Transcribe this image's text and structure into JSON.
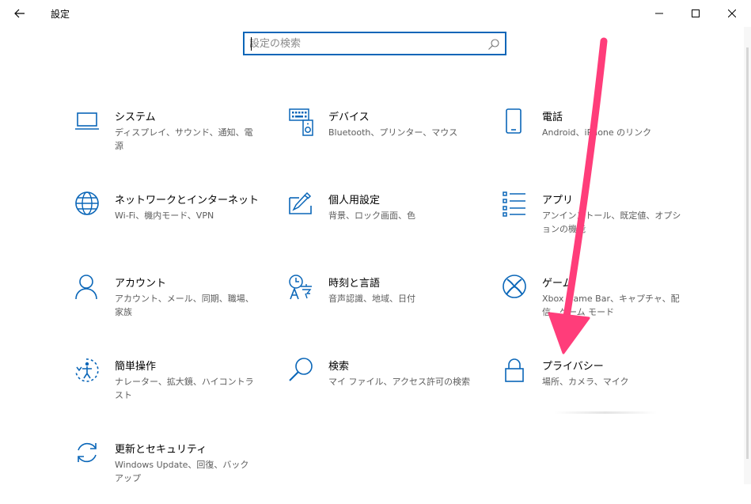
{
  "window": {
    "title": "設定"
  },
  "search": {
    "placeholder": "設定の検索",
    "value": ""
  },
  "tiles": [
    {
      "name": "システム",
      "desc": "ディスプレイ、サウンド、通知、電源",
      "icon": "laptop-icon"
    },
    {
      "name": "デバイス",
      "desc": "Bluetooth、プリンター、マウス",
      "icon": "devices-icon"
    },
    {
      "name": "電話",
      "desc": "Android、iPhone のリンク",
      "icon": "phone-icon"
    },
    {
      "name": "ネットワークとインターネット",
      "desc": "Wi-Fi、機内モード、VPN",
      "icon": "globe-icon"
    },
    {
      "name": "個人用設定",
      "desc": "背景、ロック画面、色",
      "icon": "personalization-icon"
    },
    {
      "name": "アプリ",
      "desc": "アンインストール、既定値、オプションの機能",
      "icon": "apps-list-icon"
    },
    {
      "name": "アカウント",
      "desc": "アカウント、メール、同期、職場、家族",
      "icon": "person-icon"
    },
    {
      "name": "時刻と言語",
      "desc": "音声認識、地域、日付",
      "icon": "time-language-icon"
    },
    {
      "name": "ゲーム",
      "desc": "Xbox Game Bar、キャプチャ、配信、ゲーム モード",
      "icon": "xbox-icon"
    },
    {
      "name": "簡単操作",
      "desc": "ナレーター、拡大鏡、ハイコントラスト",
      "icon": "ease-of-access-icon"
    },
    {
      "name": "検索",
      "desc": "マイ ファイル、アクセス許可の検索",
      "icon": "search-icon"
    },
    {
      "name": "プライバシー",
      "desc": "場所、カメラ、マイク",
      "icon": "lock-icon"
    },
    {
      "name": "更新とセキュリティ",
      "desc": "Windows Update、回復、バックアップ",
      "icon": "sync-icon"
    }
  ],
  "colors": {
    "accent": "#0a66b8",
    "arrow": "#ff3d7a"
  }
}
